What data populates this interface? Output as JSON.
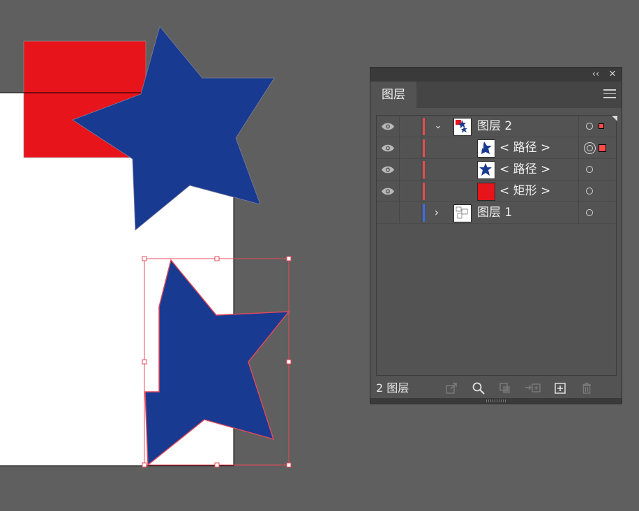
{
  "panel": {
    "collapse_glyph": "‹‹",
    "close_glyph": "✕",
    "tab_label": "图层",
    "menu_icon": "hamburger-menu-icon",
    "layers": [
      {
        "name": "图层 2",
        "visible": true,
        "color": "#e84a4a",
        "expanded": true,
        "selected_indicator": true
      },
      {
        "name": "< 路径 >",
        "visible": true,
        "color": "#e84a4a",
        "targeted": true,
        "selected_indicator": true
      },
      {
        "name": "< 路径 >",
        "visible": true,
        "color": "#e84a4a"
      },
      {
        "name": "< 矩形 >",
        "visible": true,
        "color": "#e84a4a"
      },
      {
        "name": "图层 1",
        "visible": false,
        "color": "#3a6cf0",
        "expanded": false
      }
    ],
    "footer": {
      "count_label": "2 图层",
      "icons": [
        "export-icon",
        "search-icon",
        "clip-mask-icon",
        "move-to-layer-icon",
        "new-layer-icon",
        "trash-icon"
      ]
    }
  },
  "colors": {
    "star_blue": "#183b91",
    "rect_red": "#e8141c",
    "selection": "#e8485a",
    "canvas": "#5f5f5f",
    "artboard": "#ffffff"
  }
}
